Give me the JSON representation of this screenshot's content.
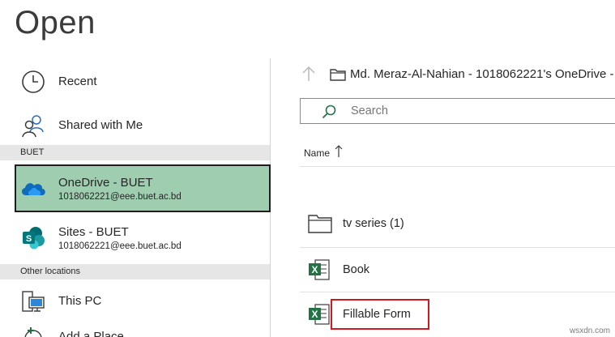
{
  "title": "Open",
  "locations": {
    "recent": {
      "label": "Recent",
      "icon": "clock-icon"
    },
    "shared": {
      "label": "Shared with Me",
      "icon": "people-icon"
    },
    "group1": "BUET",
    "onedrive": {
      "label": "OneDrive - BUET",
      "sub": "1018062221@eee.buet.ac.bd",
      "icon": "onedrive-cloud-icon"
    },
    "sites": {
      "label": "Sites - BUET",
      "sub": "1018062221@eee.buet.ac.bd",
      "icon": "sharepoint-icon"
    },
    "group2": "Other locations",
    "thispc": {
      "label": "This PC",
      "icon": "computer-icon"
    },
    "addplace": {
      "label": "Add a Place",
      "icon": "globe-plus-icon"
    }
  },
  "browser": {
    "breadcrumb": "Md. Meraz-Al-Nahian - 1018062221's OneDrive -",
    "search_placeholder": "Search",
    "column_name": "Name",
    "files": [
      {
        "name": "tv series (1)",
        "type": "folder"
      },
      {
        "name": "Book",
        "type": "excel"
      },
      {
        "name": "Fillable Form",
        "type": "excel"
      }
    ]
  },
  "colors": {
    "accent": "#217346",
    "selected_bg": "#9ecdb0",
    "highlight": "#d0191e"
  },
  "watermark": "wsxdn.com"
}
